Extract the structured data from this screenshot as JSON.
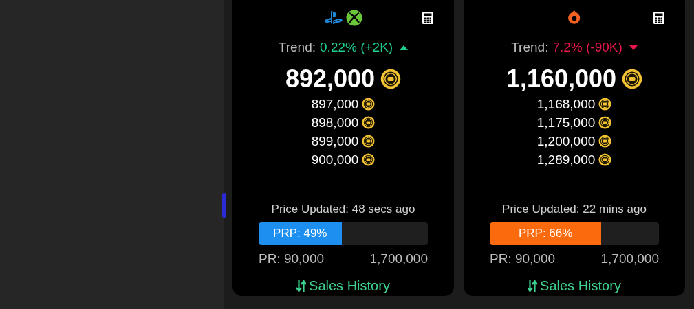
{
  "cards": [
    {
      "platforms": [
        {
          "kind": "playstation"
        },
        {
          "kind": "xbox"
        }
      ],
      "trend_label": "Trend:",
      "trend_value": "0.22% (+2K)",
      "trend_up": true,
      "price": "892,000",
      "other_prices": [
        "897,000",
        "898,000",
        "899,000",
        "900,000"
      ],
      "updated": "Price Updated: 48 secs ago",
      "prp_label": "PRP: 49%",
      "level": 0.49,
      "color": "#1d8ff0",
      "pr_min": "PR: 90,000",
      "pr_max": "1,700,000",
      "sales_history": "Sales History"
    },
    {
      "platforms": [
        {
          "kind": "origin"
        }
      ],
      "trend_label": "Trend:",
      "trend_value": "7.2% (-90K)",
      "trend_up": false,
      "price": "1,160,000",
      "other_prices": [
        "1,168,000",
        "1,175,000",
        "1,200,000",
        "1,289,000"
      ],
      "updated": "Price Updated: 22 mins ago",
      "prp_label": "PRP: 66%",
      "level": 0.66,
      "color": "#fb6a0c",
      "pr_min": "PR: 90,000",
      "pr_max": "1,700,000",
      "sales_history": "Sales History"
    }
  ]
}
